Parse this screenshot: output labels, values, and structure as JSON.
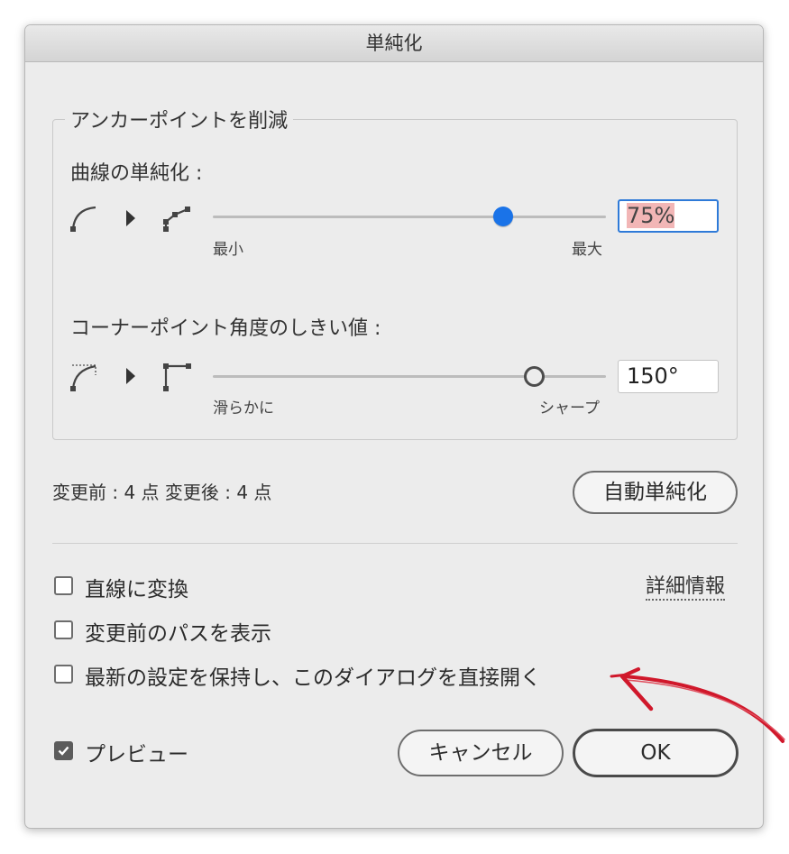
{
  "dialog": {
    "title": "単純化"
  },
  "anchor_group": {
    "legend": "アンカーポイントを削減",
    "curve": {
      "label": "曲線の単純化 :",
      "value_selected": "75%",
      "value_percent": 75,
      "min_label": "最小",
      "max_label": "最大"
    },
    "corner": {
      "label": "コーナーポイント角度のしきい値 :",
      "value": "150°",
      "value_degrees": 150,
      "min_label": "滑らかに",
      "max_label": "シャープ"
    }
  },
  "stats": {
    "text": "変更前 : 4 点  変更後 : 4 点"
  },
  "buttons": {
    "auto_simplify": "自動単純化",
    "cancel": "キャンセル",
    "ok": "OK"
  },
  "options": {
    "to_line": {
      "label": "直線に変換",
      "checked": false
    },
    "show_original": {
      "label": "変更前のパスを表示",
      "checked": false
    },
    "keep_settings": {
      "label": "最新の設定を保持し、このダイアログを直接開く",
      "checked": false
    },
    "preview": {
      "label": "プレビュー",
      "checked": true
    }
  },
  "details_link": "詳細情報",
  "colors": {
    "accent": "#1a73e8",
    "selection": "#f2b6b6",
    "annotation_arrow": "#d0182b"
  }
}
